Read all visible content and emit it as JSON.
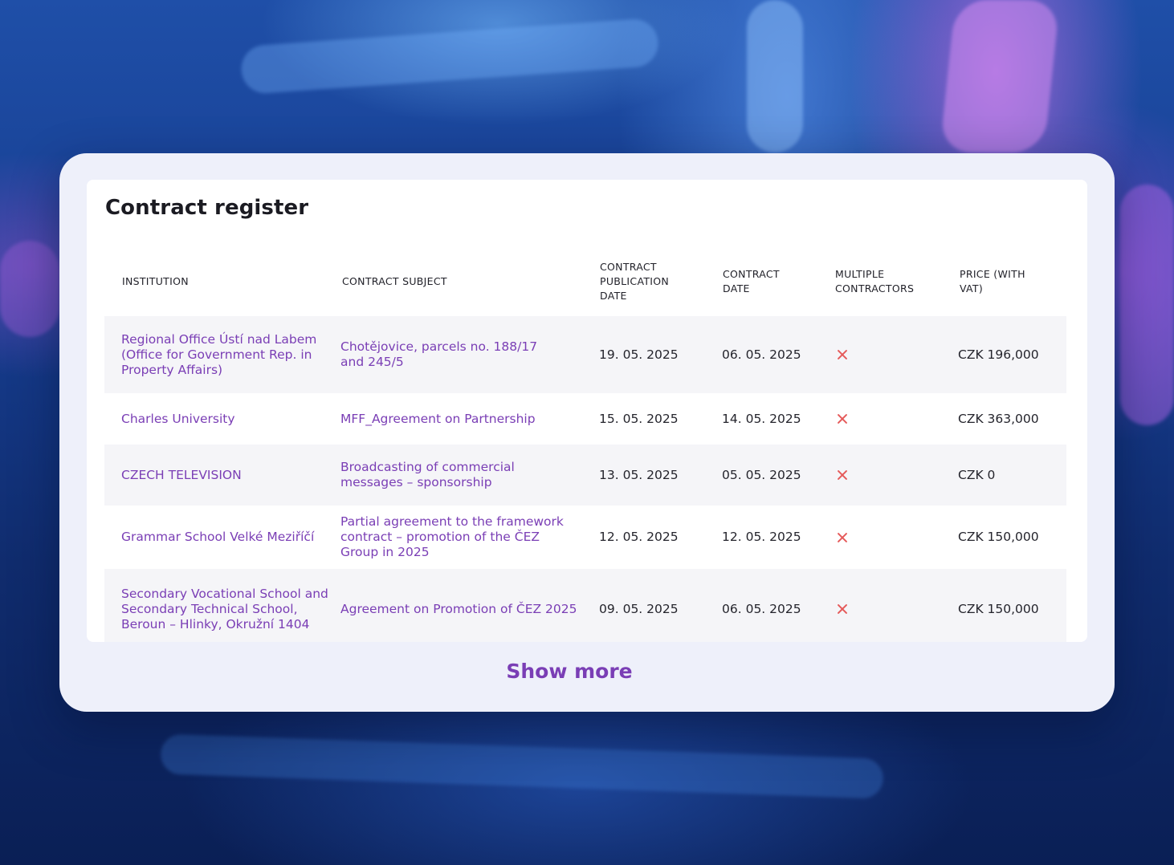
{
  "title": "Contract register",
  "columns": {
    "institution": "INSTITUTION",
    "subject": "CONTRACT SUBJECT",
    "publication_date": "CONTRACT PUBLICATION DATE",
    "contract_date": "CONTRACT DATE",
    "multiple_contractors": "MULTIPLE CONTRACTORS",
    "price": "PRICE (WITH VAT)"
  },
  "rows": [
    {
      "institution": "Regional Office Ústí nad Labem (Office for Government Rep. in Property Affairs)",
      "subject": "Chotějovice, parcels no. 188/17 and 245/5",
      "publication_date": "19. 05. 2025",
      "contract_date": "06. 05. 2025",
      "multiple_contractors": false,
      "price": "CZK 196,000"
    },
    {
      "institution": "Charles University",
      "subject": "MFF_Agreement on Partnership",
      "publication_date": "15. 05. 2025",
      "contract_date": "14. 05. 2025",
      "multiple_contractors": false,
      "price": "CZK 363,000"
    },
    {
      "institution": "CZECH TELEVISION",
      "subject": "Broadcasting of commercial messages – sponsorship",
      "publication_date": "13. 05. 2025",
      "contract_date": "05. 05. 2025",
      "multiple_contractors": false,
      "price": "CZK 0"
    },
    {
      "institution": "Grammar School Velké Meziříčí",
      "subject": "Partial agreement to the framework contract – promotion of the ČEZ Group in 2025",
      "publication_date": "12. 05. 2025",
      "contract_date": "12. 05. 2025",
      "multiple_contractors": false,
      "price": "CZK 150,000"
    },
    {
      "institution": "Secondary Vocational School and Secondary Technical School, Beroun – Hlinky, Okružní 1404",
      "subject": "Agreement on Promotion of ČEZ 2025",
      "publication_date": "09. 05. 2025",
      "contract_date": "06. 05. 2025",
      "multiple_contractors": false,
      "price": "CZK 150,000"
    }
  ],
  "icons": {
    "multiple_contractors_no": "close-icon"
  },
  "colors": {
    "link": "#7a3eb5",
    "cross": "#e55a5a",
    "card": "#eef0fa"
  },
  "show_more_label": "Show more"
}
